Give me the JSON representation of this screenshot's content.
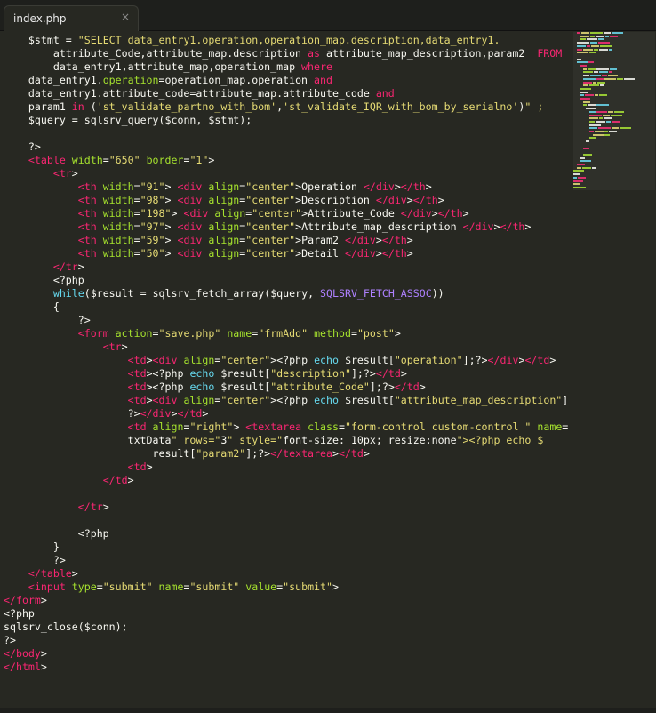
{
  "tab": {
    "filename": "index.php",
    "close_glyph": "×"
  },
  "colors": {
    "background": "#272822",
    "text": "#f8f8f2",
    "keyword": "#f92672",
    "string": "#e6db74",
    "attribute": "#a6e22e",
    "function": "#66d9ef",
    "constant": "#ae81ff"
  },
  "code_lines": [
    "    $stmt = \"SELECT data_entry1.operation,operation_map.description,data_entry1.",
    "        attribute_Code,attribute_map.description as attribute_map_description,param2  FROM",
    "        data_entry1,attribute_map,operation_map where",
    "    data_entry1.operation=operation_map.operation and",
    "    data_entry1.attribute_code=attribute_map.attribute_code and",
    "    param1 in ('st_validate_partno_with_bom','st_validate_IQR_with_bom_by_serialno')\" ;",
    "    $query = sqlsrv_query($conn, $stmt);",
    "",
    "    ?>",
    "    <table width=\"650\" border=\"1\">",
    "        <tr>",
    "            <th width=\"91\"> <div align=\"center\">Operation </div></th>",
    "            <th width=\"98\"> <div align=\"center\">Description </div></th>",
    "            <th width=\"198\"> <div align=\"center\">Attribute_Code </div></th>",
    "            <th width=\"97\"> <div align=\"center\">Attribute_map_description </div></th>",
    "            <th width=\"59\"> <div align=\"center\">Param2 </div></th>",
    "            <th width=\"50\"> <div align=\"center\">Detail </div></th>",
    "        </tr>",
    "        <?php",
    "        while($result = sqlsrv_fetch_array($query, SQLSRV_FETCH_ASSOC))",
    "        {",
    "            ?>",
    "            <form action=\"save.php\" name=\"frmAdd\" method=\"post\">",
    "                <tr>",
    "                    <td><div align=\"center\"><?php echo $result[\"operation\"];?></div></td>",
    "                    <td><?php echo $result[\"description\"];?></td>",
    "                    <td><?php echo $result[\"attribute_Code\"];?></td>",
    "                    <td><div align=\"center\"><?php echo $result[\"attribute_map_description\"];",
    "                    ?></div></td>",
    "                    <td align=\"right\"> <textarea class=\"form-control custom-control \" name=\"",
    "                    txtData\" rows=\"3\" style=\"font-size: 10px; resize:none\"><?php echo $",
    "                        result[\"param2\"];?></textarea></td>",
    "                    <td>",
    "                </td>",
    "",
    "            </tr>",
    "",
    "            <?php",
    "        }",
    "        ?>",
    "    </table>",
    "    <input type=\"submit\" name=\"submit\" value=\"submit\">",
    "</form>",
    "<?php",
    "sqlsrv_close($conn);",
    "?>",
    "</body>",
    "</html>"
  ]
}
